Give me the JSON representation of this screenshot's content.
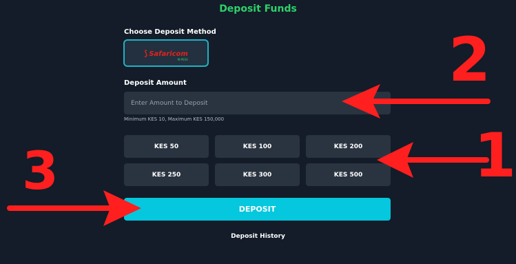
{
  "page": {
    "title": "Deposit Funds"
  },
  "method": {
    "label": "Choose Deposit Method",
    "selected": "Safaricom",
    "logo_subtext": "M-PESA"
  },
  "amount": {
    "label": "Deposit Amount",
    "placeholder": "Enter Amount to Deposit",
    "hint": "Minimum KES 10, Maximum KES 150,000"
  },
  "quick_amounts": [
    "KES 50",
    "KES 100",
    "KES 200",
    "KES 250",
    "KES 300",
    "KES 500"
  ],
  "actions": {
    "deposit": "DEPOSIT",
    "history": "Deposit History"
  },
  "annotations": {
    "one": "1",
    "two": "2",
    "three": "3",
    "color": "#ff1f1f"
  },
  "colors": {
    "background": "#131c28",
    "title": "#2fd16a",
    "accent": "#05c7de",
    "field": "#2a3441"
  }
}
